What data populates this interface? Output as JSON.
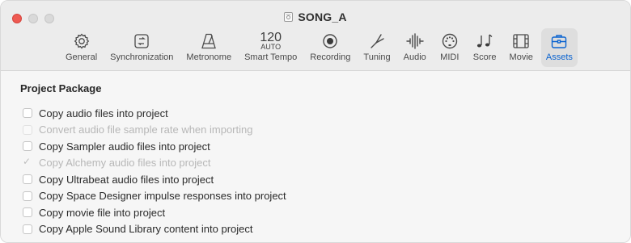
{
  "window": {
    "title": "SONG_A"
  },
  "tabs": [
    {
      "label": "General",
      "icon": "gear-icon"
    },
    {
      "label": "Synchronization",
      "icon": "sync-icon"
    },
    {
      "label": "Metronome",
      "icon": "metronome-icon"
    },
    {
      "label": "Smart Tempo",
      "icon": "tempo-readout",
      "tempo_value": "120",
      "tempo_mode": "AUTO"
    },
    {
      "label": "Recording",
      "icon": "record-icon"
    },
    {
      "label": "Tuning",
      "icon": "tuning-fork-icon"
    },
    {
      "label": "Audio",
      "icon": "waveform-icon"
    },
    {
      "label": "MIDI",
      "icon": "midi-icon"
    },
    {
      "label": "Score",
      "icon": "notes-icon"
    },
    {
      "label": "Movie",
      "icon": "film-icon"
    },
    {
      "label": "Assets",
      "icon": "briefcase-icon",
      "active": true
    }
  ],
  "section": {
    "title": "Project Package"
  },
  "options": [
    {
      "label": "Copy audio files into project",
      "checked": false,
      "disabled": false
    },
    {
      "label": "Convert audio file sample rate when importing",
      "checked": false,
      "disabled": true
    },
    {
      "label": "Copy Sampler audio files into project",
      "checked": false,
      "disabled": false
    },
    {
      "label": "Copy Alchemy audio files into project",
      "checked": true,
      "disabled": true
    },
    {
      "label": "Copy Ultrabeat audio files into project",
      "checked": false,
      "disabled": false
    },
    {
      "label": "Copy Space Designer impulse responses into project",
      "checked": false,
      "disabled": false
    },
    {
      "label": "Copy movie file into project",
      "checked": false,
      "disabled": false
    },
    {
      "label": "Copy Apple Sound Library content into project",
      "checked": false,
      "disabled": false
    }
  ],
  "colors": {
    "accent": "#0a63d0",
    "close_button": "#ee5a52",
    "toolbar_bg": "#ececec",
    "content_bg": "#f6f6f6"
  }
}
